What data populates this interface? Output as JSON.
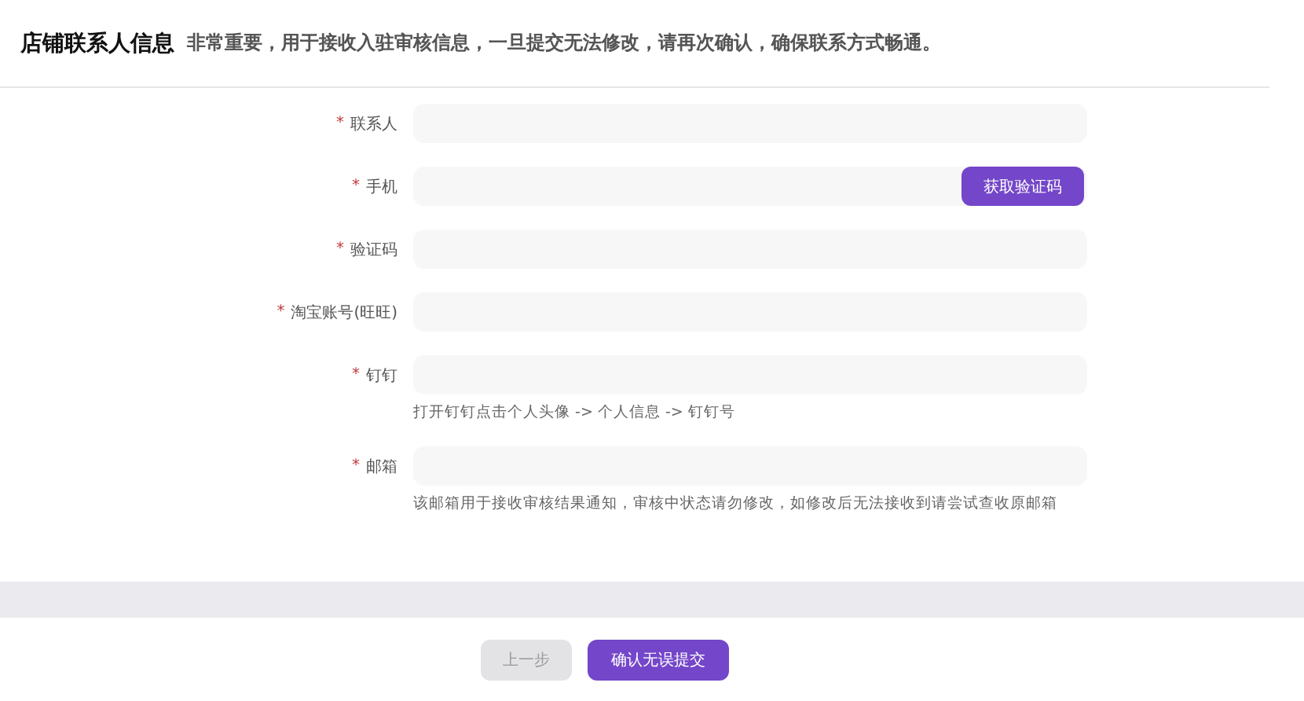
{
  "header": {
    "title": "店铺联系人信息",
    "subtitle": "非常重要，用于接收入驻审核信息，一旦提交无法修改，请再次确认，确保联系方式畅通。"
  },
  "fields": [
    {
      "label": "联系人",
      "required_mark": "*"
    },
    {
      "label": "手机",
      "required_mark": "*",
      "action": "获取验证码"
    },
    {
      "label": "验证码",
      "required_mark": "*"
    },
    {
      "label": "淘宝账号(旺旺)",
      "required_mark": "*"
    },
    {
      "label": "钉钉",
      "required_mark": "*",
      "hint": "打开钉钉点击个人头像 -> 个人信息 -> 钉钉号"
    },
    {
      "label": "邮箱",
      "required_mark": "*",
      "hint": "该邮箱用于接收审核结果通知，审核中状态请勿修改，如修改后无法接收到请尝试查收原邮箱"
    }
  ],
  "footer_buttons": [
    {
      "label": "上一步",
      "disabled": true
    },
    {
      "label": "确认无误提交",
      "disabled": false
    }
  ]
}
